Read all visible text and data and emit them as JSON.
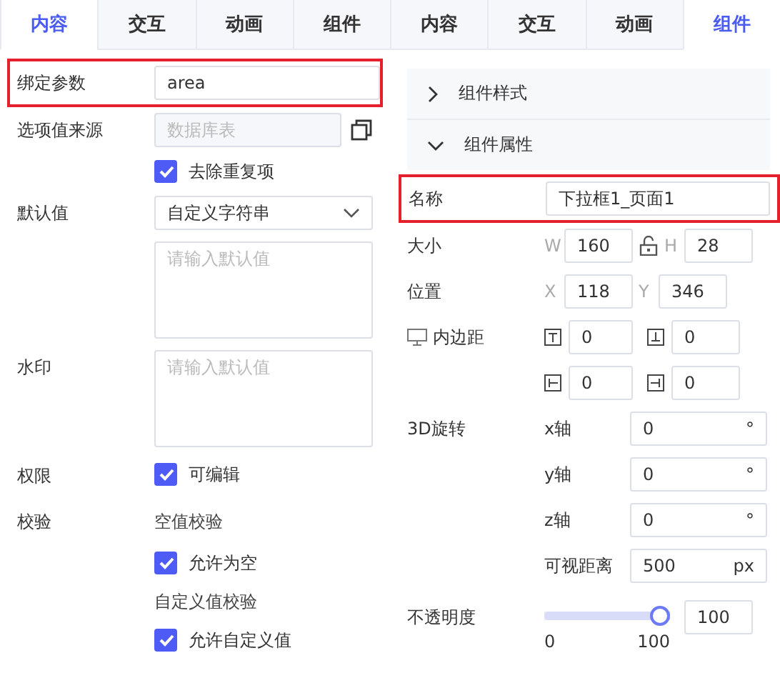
{
  "left_panel": {
    "tabs": [
      {
        "label": "内容",
        "selected": true
      },
      {
        "label": "交互",
        "selected": false
      },
      {
        "label": "动画",
        "selected": false
      },
      {
        "label": "组件",
        "selected": false
      }
    ],
    "rows": [
      {
        "kind": "input",
        "label": "绑定参数",
        "value": "area",
        "highlighted": true
      },
      {
        "kind": "source",
        "label": "选项值来源",
        "placeholder": "数据库表",
        "disabled": true
      },
      {
        "kind": "checkbox",
        "text": "去除重复项",
        "checked": true
      },
      {
        "kind": "select",
        "label": "默认值",
        "value": "自定义字符串"
      },
      {
        "kind": "textarea",
        "placeholder": "请输入默认值"
      },
      {
        "kind": "textarea",
        "label": "水印",
        "placeholder": "请输入默认值"
      },
      {
        "kind": "checkbox",
        "label": "权限",
        "text": "可编辑",
        "checked": true
      },
      {
        "kind": "note",
        "label": "校验",
        "text": "空值校验"
      },
      {
        "kind": "checkbox",
        "text": "允许为空",
        "checked": true
      },
      {
        "kind": "note",
        "text": "自定义值校验"
      },
      {
        "kind": "checkbox",
        "text": "允许自定义值",
        "checked": true
      }
    ]
  },
  "right_panel": {
    "tabs": [
      {
        "label": "内容",
        "selected": false
      },
      {
        "label": "交互",
        "selected": false
      },
      {
        "label": "动画",
        "selected": false
      },
      {
        "label": "组件",
        "selected": true
      }
    ],
    "sections": [
      {
        "title": "组件样式",
        "expanded": false
      },
      {
        "title": "组件属性",
        "expanded": true
      }
    ],
    "rows": [
      {
        "kind": "input",
        "label": "名称",
        "value": "下拉框1_页面1",
        "highlighted": true
      },
      {
        "kind": "pair",
        "label": "大小",
        "lock": true,
        "items": [
          {
            "prefix": "W",
            "value": "160"
          },
          {
            "prefix": "H",
            "value": "28"
          }
        ]
      },
      {
        "kind": "pair",
        "label": "位置",
        "items": [
          {
            "prefix": "X",
            "value": "118"
          },
          {
            "prefix": "Y",
            "value": "346"
          }
        ]
      },
      {
        "kind": "padding",
        "label": "内边距",
        "items": [
          {
            "kind": "top",
            "value": "0"
          },
          {
            "kind": "bottom",
            "value": "0"
          },
          {
            "kind": "left",
            "value": "0"
          },
          {
            "kind": "right",
            "value": "0"
          }
        ]
      },
      {
        "kind": "axes",
        "label": "3D旋转",
        "items": [
          {
            "axis": "x轴",
            "value": "0",
            "unit": "°"
          },
          {
            "axis": "y轴",
            "value": "0",
            "unit": "°"
          },
          {
            "axis": "z轴",
            "value": "0",
            "unit": "°"
          },
          {
            "axis": "可视距离",
            "value": "500",
            "unit": "px"
          }
        ]
      },
      {
        "kind": "slider",
        "label": "不透明度",
        "level": 1,
        "min": "0",
        "max": "100",
        "value": "100"
      }
    ]
  }
}
